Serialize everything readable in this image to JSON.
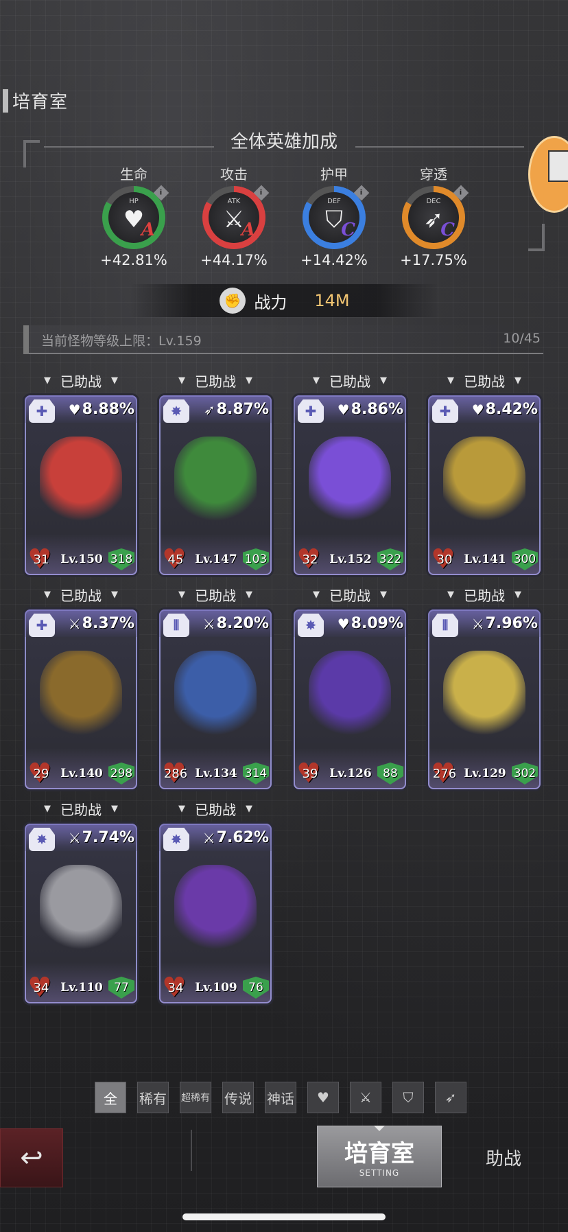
{
  "header": {
    "page_title": "培育室",
    "bonus_title": "全体英雄加成"
  },
  "stats": [
    {
      "name": "生命",
      "abbr": "HP",
      "grade": "A",
      "value": "+42.81%",
      "ring_color": "#3aa04c",
      "grade_color": "#e0413f",
      "icon": "heart-icon"
    },
    {
      "name": "攻击",
      "abbr": "ATK",
      "grade": "A",
      "value": "+44.17%",
      "ring_color": "#d94040",
      "grade_color": "#e0413f",
      "icon": "sword-icon"
    },
    {
      "name": "护甲",
      "abbr": "DEF",
      "grade": "C",
      "value": "+14.42%",
      "ring_color": "#3b7fe0",
      "grade_color": "#7a4fd6",
      "icon": "shield-icon"
    },
    {
      "name": "穿透",
      "abbr": "DEC",
      "grade": "C",
      "value": "+17.75%",
      "ring_color": "#e08a2a",
      "grade_color": "#7a4fd6",
      "icon": "pierce-icon"
    }
  ],
  "power": {
    "label": "战力",
    "value": "14M"
  },
  "level_cap": {
    "text": "当前怪物等级上限：Lv.159",
    "count": "10/45"
  },
  "assist_label": "已助战",
  "cards": [
    {
      "type_icon": "medkit-icon",
      "type_glyph": "✚",
      "bonus_icon": "heart-icon",
      "bonus_glyph": "♥",
      "bonus": "8.88%",
      "hearts": "31",
      "level": "Lv.150",
      "shield": "318",
      "color": "#c8403a"
    },
    {
      "type_icon": "burst-icon",
      "type_glyph": "✸",
      "bonus_icon": "pierce-icon",
      "bonus_glyph": "➶",
      "bonus": "8.87%",
      "hearts": "45",
      "level": "Lv.147",
      "shield": "103",
      "color": "#3f8a3c"
    },
    {
      "type_icon": "medkit-icon",
      "type_glyph": "✚",
      "bonus_icon": "heart-icon",
      "bonus_glyph": "♥",
      "bonus": "8.86%",
      "hearts": "32",
      "level": "Lv.152",
      "shield": "322",
      "color": "#7a4fd6"
    },
    {
      "type_icon": "medkit-icon",
      "type_glyph": "✚",
      "bonus_icon": "heart-icon",
      "bonus_glyph": "♥",
      "bonus": "8.42%",
      "hearts": "30",
      "level": "Lv.141",
      "shield": "300",
      "color": "#b99a3a"
    },
    {
      "type_icon": "medkit-icon",
      "type_glyph": "✚",
      "bonus_icon": "sword-icon",
      "bonus_glyph": "⚔",
      "bonus": "8.37%",
      "hearts": "29",
      "level": "Lv.140",
      "shield": "298",
      "color": "#8a6a2c"
    },
    {
      "type_icon": "tank-icon",
      "type_glyph": "⦀",
      "bonus_icon": "sword-icon",
      "bonus_glyph": "⚔",
      "bonus": "8.20%",
      "hearts": "286",
      "level": "Lv.134",
      "shield": "314",
      "color": "#3c5ea8"
    },
    {
      "type_icon": "burst-icon",
      "type_glyph": "✸",
      "bonus_icon": "heart-icon",
      "bonus_glyph": "♥",
      "bonus": "8.09%",
      "hearts": "39",
      "level": "Lv.126",
      "shield": "88",
      "color": "#5b3aa8"
    },
    {
      "type_icon": "tank-icon",
      "type_glyph": "⦀",
      "bonus_icon": "sword-icon",
      "bonus_glyph": "⚔",
      "bonus": "7.96%",
      "hearts": "276",
      "level": "Lv.129",
      "shield": "302",
      "color": "#c9b04a"
    },
    {
      "type_icon": "burst-icon",
      "type_glyph": "✸",
      "bonus_icon": "sword-icon",
      "bonus_glyph": "⚔",
      "bonus": "7.74%",
      "hearts": "34",
      "level": "Lv.110",
      "shield": "77",
      "color": "#9a9aa0"
    },
    {
      "type_icon": "burst-icon",
      "type_glyph": "✸",
      "bonus_icon": "sword-icon",
      "bonus_glyph": "⚔",
      "bonus": "7.62%",
      "hearts": "34",
      "level": "Lv.109",
      "shield": "76",
      "color": "#6a3aa8"
    }
  ],
  "filters": [
    {
      "label": "全",
      "active": true
    },
    {
      "label": "稀有"
    },
    {
      "label": "超稀有"
    },
    {
      "label": "传说"
    },
    {
      "label": "神话"
    },
    {
      "label": "",
      "icon": "heart-icon",
      "glyph": "♥"
    },
    {
      "label": "",
      "icon": "sword-icon",
      "glyph": "⚔"
    },
    {
      "label": "",
      "icon": "shield-icon",
      "glyph": "⛉"
    },
    {
      "label": "",
      "icon": "pierce-icon",
      "glyph": "➶"
    }
  ],
  "bottom": {
    "back_glyph": "↩",
    "active_tab": "培育室",
    "active_tab_sub": "SETTING",
    "other_tab": "助战"
  },
  "colors": {
    "power_value": "#f2c572",
    "assist_shield": "#3aa04c",
    "heart_badge": "#b2362a"
  }
}
